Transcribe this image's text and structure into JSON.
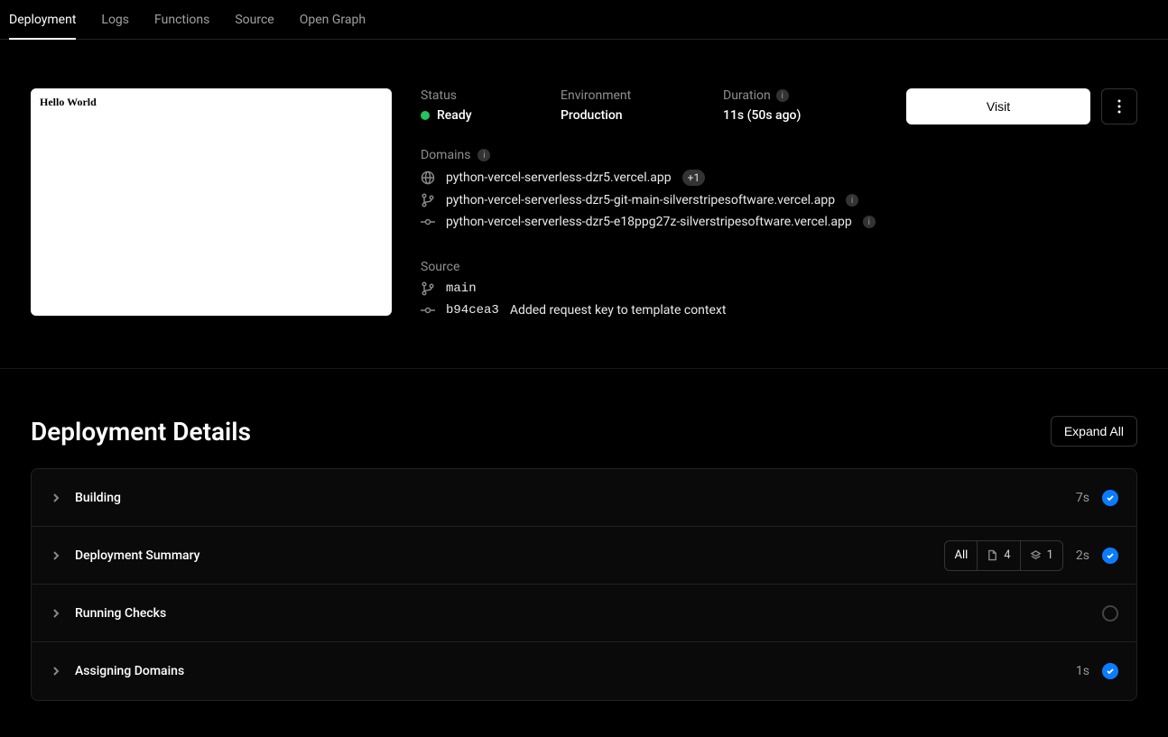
{
  "tabs": {
    "deployment": "Deployment",
    "logs": "Logs",
    "functions": "Functions",
    "source": "Source",
    "open_graph": "Open Graph"
  },
  "preview": {
    "text": "Hello World"
  },
  "meta": {
    "status_label": "Status",
    "status_value": "Ready",
    "environment_label": "Environment",
    "environment_value": "Production",
    "duration_label": "Duration",
    "duration_value": "11s (50s ago)"
  },
  "actions": {
    "visit": "Visit"
  },
  "domains": {
    "label": "Domains",
    "items": [
      "python-vercel-serverless-dzr5.vercel.app",
      "python-vercel-serverless-dzr5-git-main-silverstripesoftware.vercel.app",
      "python-vercel-serverless-dzr5-e18ppg27z-silverstripesoftware.vercel.app"
    ],
    "extra_count": "+1"
  },
  "source": {
    "label": "Source",
    "branch": "main",
    "commit_hash": "b94cea3",
    "commit_message": "Added request key to template context"
  },
  "details": {
    "title": "Deployment Details",
    "expand": "Expand All"
  },
  "steps": {
    "building": {
      "label": "Building",
      "duration": "7s"
    },
    "summary": {
      "label": "Deployment Summary",
      "duration": "2s",
      "all": "All",
      "files": "4",
      "assets": "1"
    },
    "checks": {
      "label": "Running Checks"
    },
    "domains": {
      "label": "Assigning Domains",
      "duration": "1s"
    }
  }
}
